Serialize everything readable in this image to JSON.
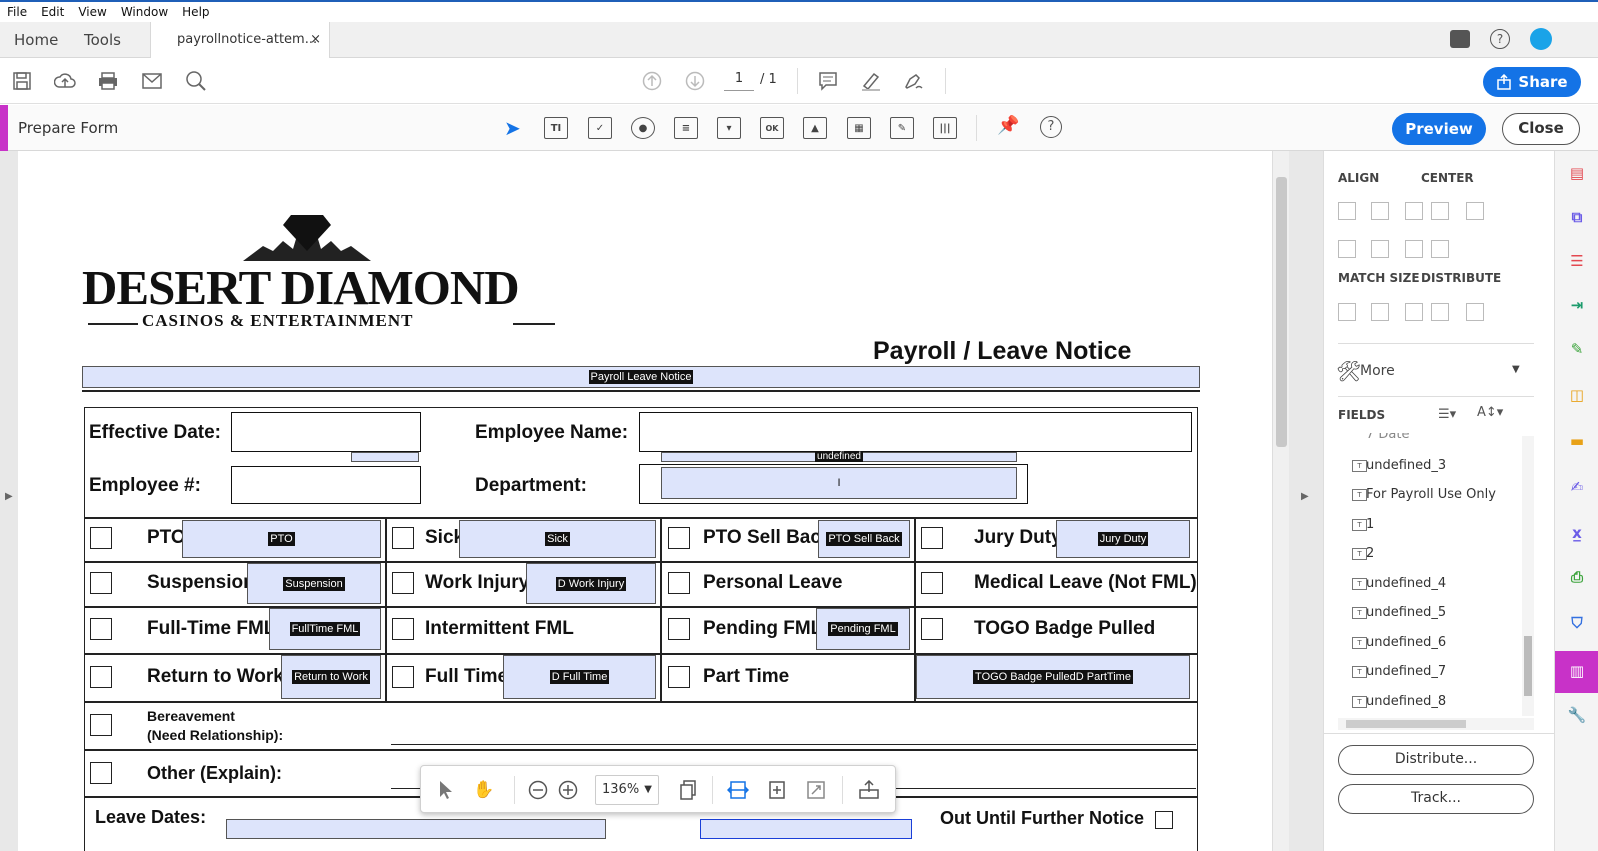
{
  "menu": [
    "File",
    "Edit",
    "View",
    "Window",
    "Help"
  ],
  "tabs": {
    "home": "Home",
    "tools": "Tools",
    "doc": "payrollnotice-attem...",
    "doc_close": "×"
  },
  "toolbar": {
    "page_current": "1",
    "page_total": "/ 1",
    "share": "Share"
  },
  "formbar": {
    "title": "Prepare Form",
    "preview": "Preview",
    "close": "Close"
  },
  "panel": {
    "align": "ALIGN",
    "center": "CENTER",
    "match_size": "MATCH SIZE",
    "distribute": "DISTRIBUTE",
    "more": "More",
    "fields": "FIELDS",
    "field_items": [
      "undefined_3",
      "For Payroll Use Only",
      "1",
      "2",
      "undefined_4",
      "undefined_5",
      "undefined_6",
      "undefined_7",
      "undefined_8"
    ],
    "partial_item": "7 Date",
    "distribute_btn": "Distribute...",
    "track_btn": "Track..."
  },
  "document": {
    "logo_main": "DESERT DIAMOND",
    "logo_sub": "CASINOS & ENTERTAINMENT",
    "title": "Payroll / Leave Notice",
    "title_field": "Payroll  Leave Notice",
    "effective_date": "Effective Date:",
    "employee_name": "Employee Name:",
    "employee_num": "Employee #:",
    "department": "Department:",
    "undefined_field": "undefined",
    "dept_field": "I",
    "row1": {
      "pto": "PTO",
      "pto_field": "PTO",
      "sick": "Sick",
      "sick_field": "Sick",
      "pto_sell": "PTO Sell Back",
      "pto_sell_field": "PTO Sell Back",
      "jury": "Jury Duty",
      "jury_field": "Jury Duty"
    },
    "row2": {
      "suspension": "Suspension",
      "suspension_field": "Suspension",
      "work_injury": "Work Injury",
      "work_injury_field": "D Work Injury",
      "personal": "Personal Leave",
      "medical": "Medical Leave (Not FML)"
    },
    "row3": {
      "fulltime_fml": "Full-Time FML",
      "fulltime_fml_field": "FullTime FML",
      "intermittent": "Intermittent FML",
      "pending": "Pending FML",
      "pending_field": "Pending FML",
      "togo": "TOGO Badge Pulled"
    },
    "row4": {
      "return": "Return to Work",
      "return_field": "Return to Work",
      "full_time": "Full Time",
      "full_time_field": "D Full Time",
      "part_time": "Part Time",
      "togo_field": "TOGO Badge PulledD PartTime"
    },
    "bereavement_1": "Bereavement",
    "bereavement_2": "(Need Relationship):",
    "other": "Other (Explain):",
    "leave_dates": "Leave Dates:",
    "out_until": "Out Until Further Notice"
  },
  "floatbar": {
    "zoom": "136%"
  }
}
